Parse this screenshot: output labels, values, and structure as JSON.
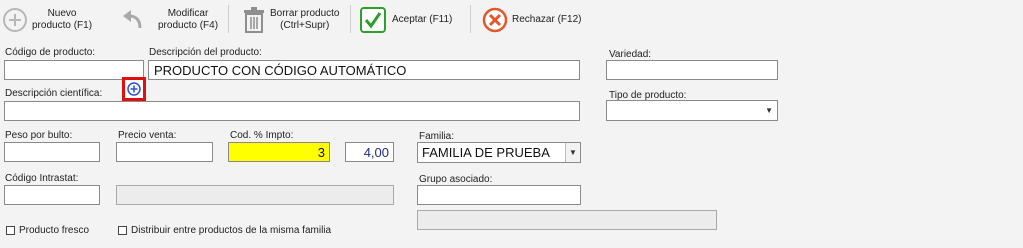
{
  "toolbar": {
    "new_label_1": "Nuevo",
    "new_label_2": "producto (F1)",
    "edit_label_1": "Modificar",
    "edit_label_2": "producto (F4)",
    "delete_label_1": "Borrar producto",
    "delete_label_2": "(Ctrl+Supr)",
    "accept_label": "Aceptar (F11)",
    "reject_label": "Rechazar (F12)"
  },
  "form": {
    "codigo_label": "Código de producto:",
    "codigo_value": "",
    "descripcion_label": "Descripción del producto:",
    "descripcion_value": "PRODUCTO CON CÓDIGO AUTOMÁTICO",
    "variedad_label": "Variedad:",
    "variedad_value": "",
    "cientifica_label": "Descripción científica:",
    "cientifica_value": "",
    "tipo_label": "Tipo de producto:",
    "tipo_value": "",
    "peso_label": "Peso por bulto:",
    "peso_value": "",
    "precio_label": "Precio venta:",
    "precio_value": "",
    "impto_label": "Cod. % Impto:",
    "impto_code": "3",
    "impto_pct": "4,00",
    "familia_label": "Familia:",
    "familia_value": "FAMILIA DE PRUEBA",
    "intrastat_label": "Código Intrastat:",
    "intrastat_value": "",
    "grupo_label": "Grupo asociado:",
    "grupo_value": "",
    "fresco_label": "Producto fresco",
    "distribuir_label": "Distribuir entre productos de la misma familia"
  },
  "colors": {
    "highlight_yellow": "#ffff00",
    "pct_blue": "#1c2a8c",
    "accept_green": "#2e9e2e",
    "reject_red": "#e2572b",
    "annotation_red": "#e01010",
    "add_blue": "#2c4fd1"
  },
  "icons": [
    "plus-circle-icon",
    "undo-arrow-icon",
    "trash-icon",
    "check-icon",
    "x-circle-icon",
    "add-circle-icon",
    "chevron-down-icon"
  ]
}
